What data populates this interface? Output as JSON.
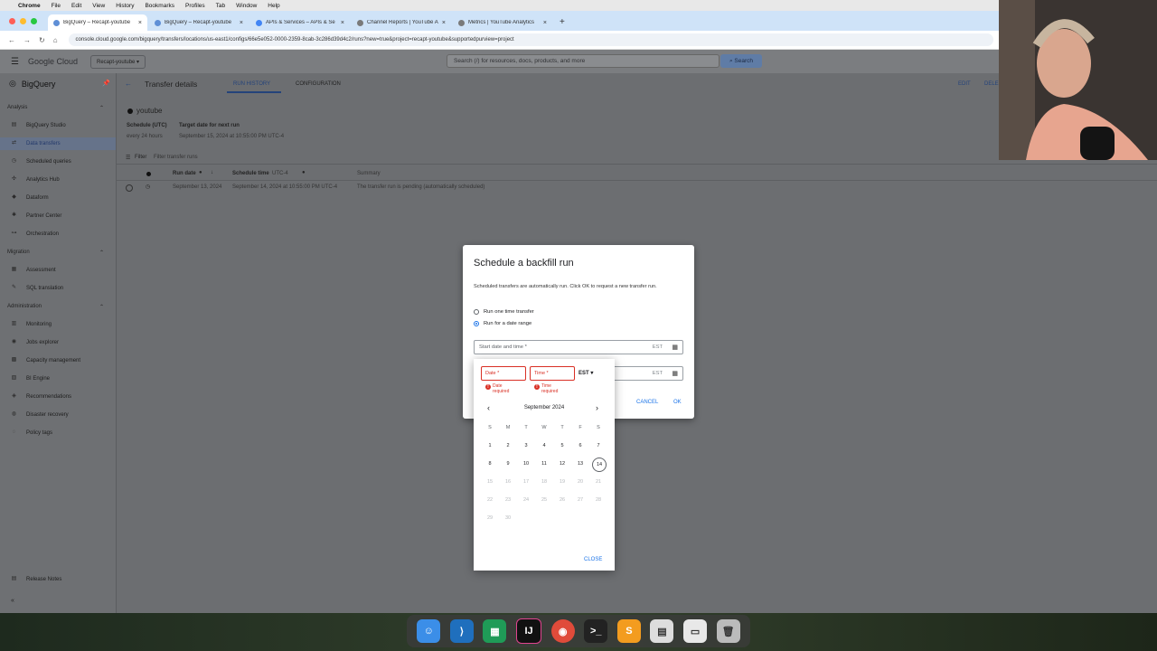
{
  "menubar": {
    "app": "Chrome",
    "items": [
      "File",
      "Edit",
      "View",
      "History",
      "Bookmarks",
      "Profiles",
      "Tab",
      "Window",
      "Help"
    ]
  },
  "tabs": [
    {
      "title": "BigQuery – Recapt-youtube"
    },
    {
      "title": "BigQuery – Recapt-youtube"
    },
    {
      "title": "APIs & Services – APIs & Se"
    },
    {
      "title": "Channel Reports | YouTube A"
    },
    {
      "title": "Metrics | YouTube Analytics"
    }
  ],
  "address": {
    "url": "console.cloud.google.com/bigquery/transfers/locations/us-east1/configs/66e5e052-0000-2359-8cab-3c286d39d4c2/runs?new=true&project=recapt-youtube&supportedpurview=project"
  },
  "gcp": {
    "logo": "Google Cloud",
    "project": "Recapt-youtube",
    "search_placeholder": "Search (/) for resources, docs, products, and more",
    "search_btn": "Search"
  },
  "nav": {
    "title": "BigQuery",
    "sections": {
      "analysis": "Analysis",
      "migration": "Migration",
      "administration": "Administration"
    },
    "analysis_items": [
      "BigQuery Studio",
      "Data transfers",
      "Scheduled queries",
      "Analytics Hub",
      "Dataform",
      "Partner Center",
      "Orchestration"
    ],
    "migration_items": [
      "Assessment",
      "SQL translation"
    ],
    "admin_items": [
      "Monitoring",
      "Jobs explorer",
      "Capacity management",
      "BI Engine",
      "Recommendations",
      "Disaster recovery",
      "Policy tags"
    ],
    "release_notes": "Release Notes"
  },
  "main": {
    "title": "Transfer details",
    "tab_run_history": "RUN HISTORY",
    "tab_configuration": "CONFIGURATION",
    "edit": "EDIT",
    "delete": "DELE",
    "config_name": "youtube",
    "schedule_label": "Schedule (UTC)",
    "schedule_value": "every 24 hours",
    "target_label": "Target date for next run",
    "target_value": "September 15, 2024 at 10:55:00 PM UTC-4",
    "filter_label": "Filter",
    "filter_placeholder": "Filter transfer runs",
    "col_run_date": "Run date",
    "col_schedule_time": "Schedule time",
    "col_tz": "UTC-4",
    "col_summary": "Summary",
    "row_run_date": "September 13, 2024",
    "row_schedule_time": "September 14, 2024 at 10:55:00 PM UTC-4",
    "row_summary": "The transfer run is pending (automatically scheduled)"
  },
  "dialog": {
    "title": "Schedule a backfill run",
    "desc": "Scheduled transfers are automatically run. Click OK to request a new transfer run.",
    "opt_one": "Run one time transfer",
    "opt_range": "Run for a date range",
    "start_label": "Start date and time *",
    "tz": "EST",
    "cancel": "CANCEL",
    "ok": "OK"
  },
  "picker": {
    "date_label": "Date *",
    "time_label": "Time *",
    "date_err1": "Date",
    "date_err2": "required",
    "time_err1": "Time",
    "time_err2": "required",
    "tz": "EST",
    "month": "September 2024",
    "dow": [
      "S",
      "M",
      "T",
      "W",
      "T",
      "F",
      "S"
    ],
    "weeks": [
      [
        "1",
        "2",
        "3",
        "4",
        "5",
        "6",
        "7"
      ],
      [
        "8",
        "9",
        "10",
        "11",
        "12",
        "13",
        "14"
      ],
      [
        "15",
        "16",
        "17",
        "18",
        "19",
        "20",
        "21"
      ],
      [
        "22",
        "23",
        "24",
        "25",
        "26",
        "27",
        "28"
      ],
      [
        "29",
        "30"
      ]
    ],
    "close": "CLOSE"
  }
}
